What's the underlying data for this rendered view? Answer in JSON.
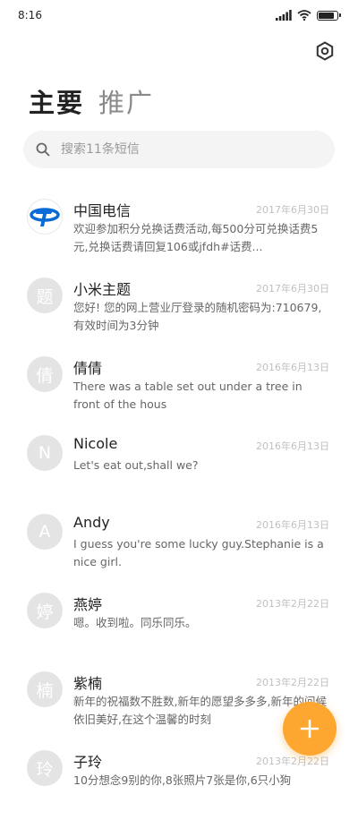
{
  "status_bar": {
    "time": "8:16",
    "battery_level": 0.85
  },
  "tabs": [
    {
      "label": "主要",
      "active": true
    },
    {
      "label": "推广",
      "active": false
    }
  ],
  "search": {
    "placeholder": "搜索11条短信"
  },
  "conversations": [
    {
      "avatar_text": "",
      "avatar_icon": "china-telecom-logo",
      "name": "中国电信",
      "date": "2017年6月30日",
      "preview": "欢迎参加积分兑换话费活动,每500分可兑换话费5元,兑换话费请回复106或jfdh#话费..."
    },
    {
      "avatar_text": "题",
      "name": "小米主题",
      "date": "2017年6月30日",
      "preview": "您好! 您的网上营业厅登录的随机密码为:710679,有效时间为3分钟"
    },
    {
      "avatar_text": "倩",
      "name": "倩倩",
      "date": "2016年6月13日",
      "preview": "There was a table set out under a tree in front of the hous"
    },
    {
      "avatar_text": "N",
      "name": "Nicole",
      "date": "2016年6月13日",
      "preview": "Let's eat out,shall we?"
    },
    {
      "avatar_text": "A",
      "name": "Andy",
      "date": "2016年6月13日",
      "preview": "I guess you're some lucky guy.Stephanie is a nice girl."
    },
    {
      "avatar_text": "婷",
      "name": "燕婷",
      "date": "2013年2月22日",
      "preview": "嗯。收到啦。同乐同乐。"
    },
    {
      "avatar_text": "楠",
      "name": "紫楠",
      "date": "2013年2月22日",
      "preview": "新年的祝福数不胜数,新年的愿望多多多,新年的问候依旧美好,在这个温馨的时刻"
    },
    {
      "avatar_text": "玲",
      "name": "子玲",
      "date": "2013年2月22日",
      "preview": "10分想念9别的你,8张照片7张是你,6只小狗"
    }
  ],
  "colors": {
    "accent": "#fda630",
    "telecom_blue": "#0a6bd6"
  }
}
